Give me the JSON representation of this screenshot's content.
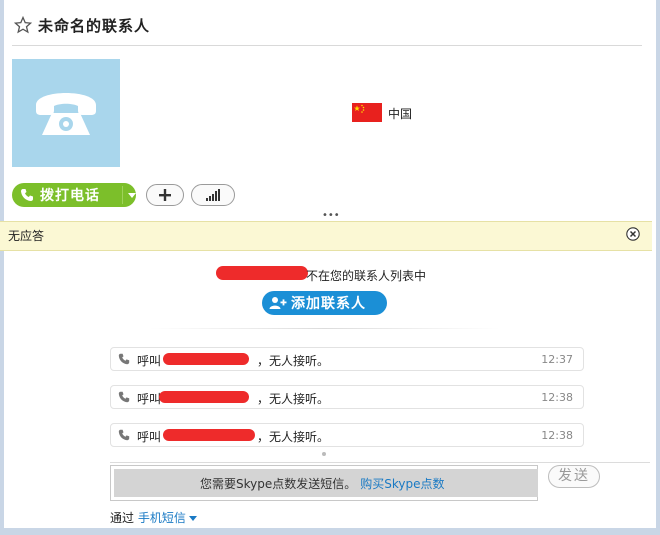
{
  "window": {
    "title": "未命名的联系人"
  },
  "profile": {
    "country": "中国",
    "flag_color": "#e8211e",
    "avatar_bg": "#a9d6ec",
    "avatar_icon": "phone-icon"
  },
  "actions": {
    "call_label": "拨打电话",
    "call_color": "#7cbf2a",
    "add_icon": "plus-icon",
    "signal_icon": "signal-bars-icon"
  },
  "notice": {
    "text": "无应答",
    "close_icon": "close-icon",
    "bg": "#fbf8d4"
  },
  "conversation": {
    "not_in_list_text": "不在您的联系人列表中",
    "add_contact_label": "添加联系人",
    "add_contact_color": "#1b8fd6",
    "messages": [
      {
        "prefix": "呼叫",
        "suffix": "，无人接听。",
        "time": "12:37"
      },
      {
        "prefix": "呼叫",
        "suffix": "，无人接听。",
        "time": "12:38"
      },
      {
        "prefix": "呼叫",
        "suffix": "，无人接听。",
        "time": "12:38"
      }
    ]
  },
  "compose": {
    "info_text": "您需要Skype点数发送短信。",
    "buy_link": "购买Skype点数",
    "send_label": "发送",
    "via_prefix": "通过",
    "via_link": "手机短信"
  }
}
